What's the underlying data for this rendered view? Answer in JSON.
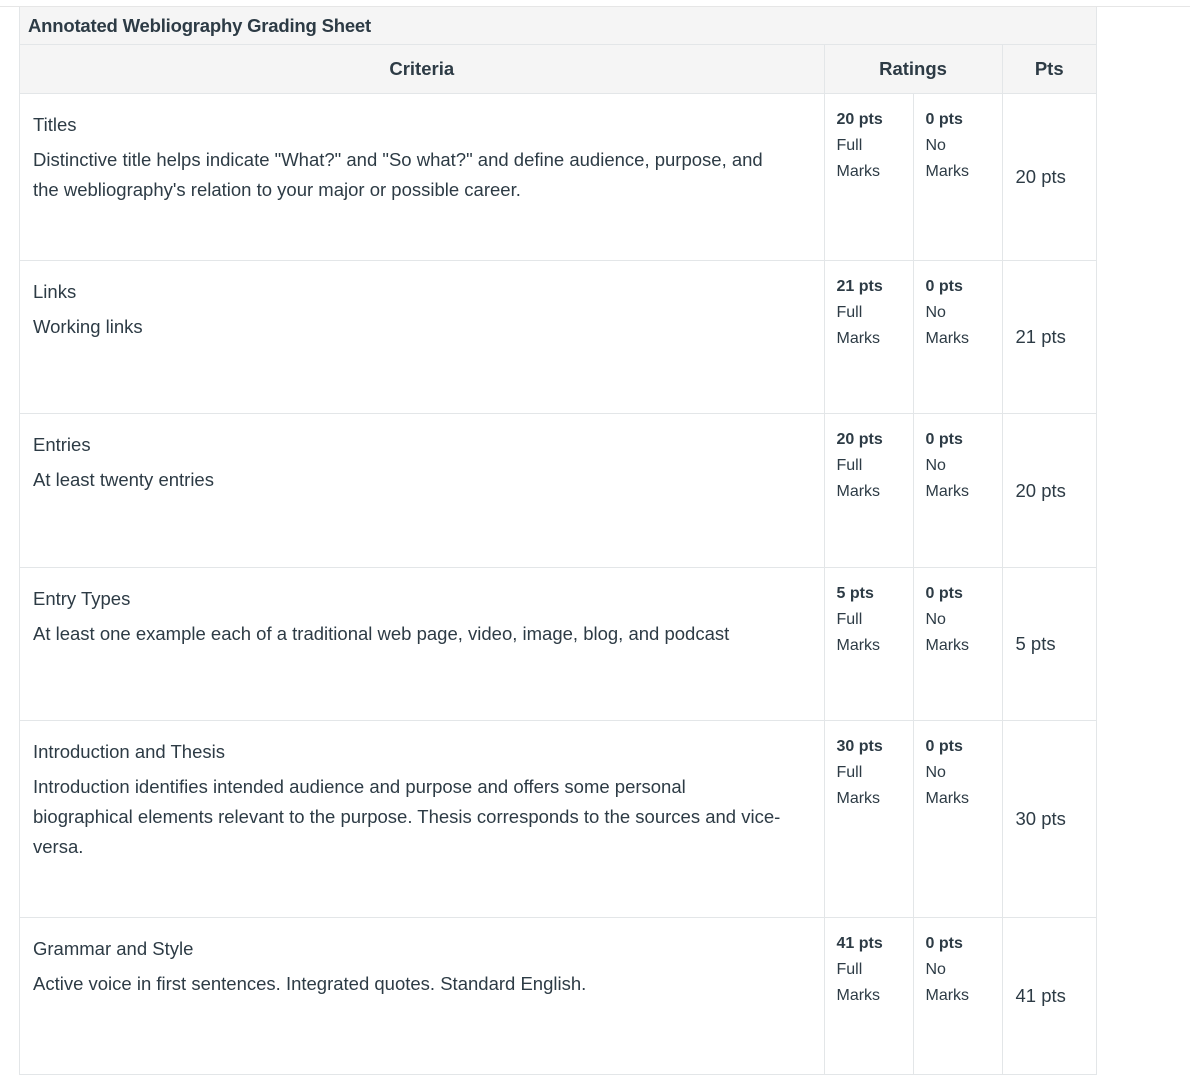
{
  "rubric": {
    "title": "Annotated Webliography Grading Sheet",
    "headers": {
      "criteria": "Criteria",
      "ratings": "Ratings",
      "pts": "Pts"
    },
    "rows": [
      {
        "title": "Titles",
        "description": "Distinctive title helps indicate \"What?\" and \"So what?\" and define audience, purpose, and the webliography's relation to your major or possible career.",
        "ratings": [
          {
            "pts": "20 pts",
            "label": "Full Marks"
          },
          {
            "pts": "0 pts",
            "label": "No Marks"
          }
        ],
        "points": "20 pts"
      },
      {
        "title": "Links",
        "description": "Working links",
        "ratings": [
          {
            "pts": "21 pts",
            "label": "Full Marks"
          },
          {
            "pts": "0 pts",
            "label": "No Marks"
          }
        ],
        "points": "21 pts"
      },
      {
        "title": "Entries",
        "description": "At least twenty entries",
        "ratings": [
          {
            "pts": "20 pts",
            "label": "Full Marks"
          },
          {
            "pts": "0 pts",
            "label": "No Marks"
          }
        ],
        "points": "20 pts"
      },
      {
        "title": "Entry Types",
        "description": "At least one example each of a traditional web page, video, image, blog, and podcast",
        "ratings": [
          {
            "pts": "5 pts",
            "label": "Full Marks"
          },
          {
            "pts": "0 pts",
            "label": "No Marks"
          }
        ],
        "points": "5 pts"
      },
      {
        "title": "Introduction and Thesis",
        "description": "Introduction identifies intended audience and purpose and offers some personal biographical elements relevant to the purpose. Thesis corresponds to the sources and vice-versa.",
        "ratings": [
          {
            "pts": "30 pts",
            "label": "Full Marks"
          },
          {
            "pts": "0 pts",
            "label": "No Marks"
          }
        ],
        "points": "30 pts"
      },
      {
        "title": "Grammar and Style",
        "description": "Active voice in first sentences. Integrated quotes. Standard English.",
        "ratings": [
          {
            "pts": "41 pts",
            "label": "Full Marks"
          },
          {
            "pts": "0 pts",
            "label": "No Marks"
          }
        ],
        "points": "41 pts"
      }
    ]
  }
}
